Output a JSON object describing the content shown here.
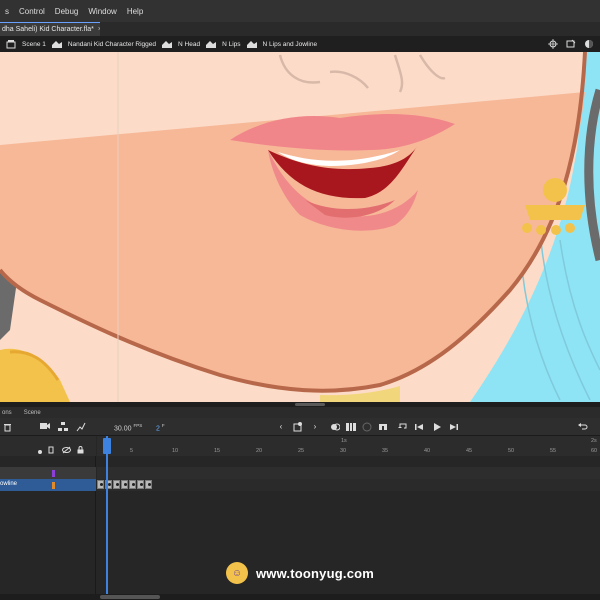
{
  "app": {
    "menu": [
      "s",
      "Control",
      "Debug",
      "Window",
      "Help"
    ],
    "document_tab": {
      "title": "dha Saheli) Kid Character.fla*",
      "close": "×"
    }
  },
  "edit_bar": {
    "crumbs": [
      "Scene 1",
      "Nandani Kid Character Rigged",
      "N Head",
      "N Lips",
      "N Lips and Jowline"
    ]
  },
  "panels": {
    "tabs": [
      "ons",
      "Scene"
    ]
  },
  "timeline": {
    "fps": "30.00",
    "fps_unit": "FPS",
    "current_frame": "2",
    "frame_unit": "F",
    "second_markers": [
      "1s",
      "2s"
    ],
    "frame_numbers": [
      "5",
      "10",
      "15",
      "20",
      "25",
      "30",
      "35",
      "40",
      "45",
      "50",
      "55",
      "60"
    ],
    "layers": [
      {
        "name": "",
        "color": "#8b3fd6",
        "selected": false
      },
      {
        "name": "owline",
        "color": "#e08a2a",
        "selected": true
      }
    ],
    "keyframe_count": 6
  },
  "watermark": {
    "url": "www.toonyug.com"
  },
  "colors": {
    "skin_light": "#fcdcc8",
    "skin_shadow": "#f4b494",
    "outline": "#b8684a",
    "lip": "#f1868a",
    "mouth": "#a8171e",
    "hair_blue": "#8ee4f5",
    "gold": "#f2c24a",
    "accent": "#3e82e0"
  }
}
